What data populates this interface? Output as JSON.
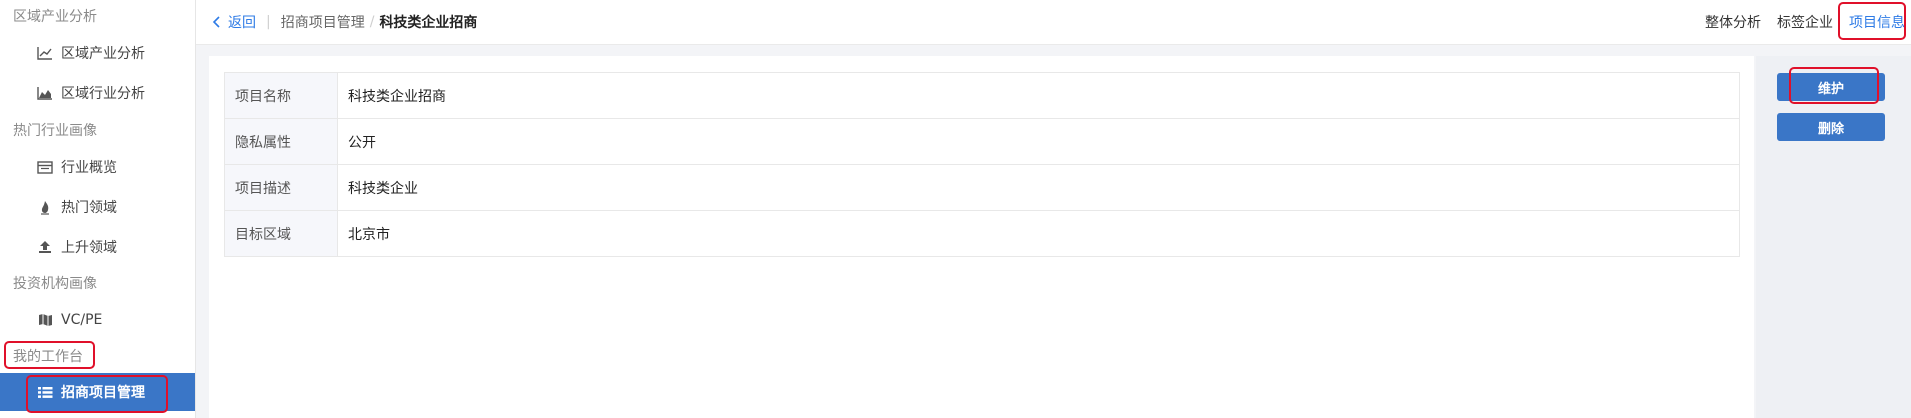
{
  "sidebar": {
    "groups": [
      {
        "label": "区域产业分析"
      },
      {
        "label": "热门行业画像"
      },
      {
        "label": "投资机构画像"
      },
      {
        "label": "我的工作台"
      }
    ],
    "items": [
      {
        "label": "区域产业分析",
        "icon": "line-chart-icon"
      },
      {
        "label": "区域行业分析",
        "icon": "area-chart-icon"
      },
      {
        "label": "行业概览",
        "icon": "panel-icon"
      },
      {
        "label": "热门领域",
        "icon": "fire-icon"
      },
      {
        "label": "上升领域",
        "icon": "upload-icon"
      },
      {
        "label": "VC/PE",
        "icon": "map-icon"
      },
      {
        "label": "招商项目管理",
        "icon": "list-icon"
      }
    ]
  },
  "header": {
    "back_label": "返回",
    "breadcrumb_parent": "招商项目管理",
    "breadcrumb_current": "科技类企业招商",
    "tabs": [
      "整体分析",
      "标签企业",
      "项目信息"
    ]
  },
  "info": {
    "rows": [
      {
        "key": "项目名称",
        "value": "科技类企业招商"
      },
      {
        "key": "隐私属性",
        "value": "公开"
      },
      {
        "key": "项目描述",
        "value": "科技类企业"
      },
      {
        "key": "目标区域",
        "value": "北京市"
      }
    ]
  },
  "actions": {
    "maintain_label": "维护",
    "delete_label": "删除"
  },
  "colors": {
    "accent": "#2e7be6",
    "primary_button": "#3a76c7",
    "highlight": "#e0102a"
  }
}
